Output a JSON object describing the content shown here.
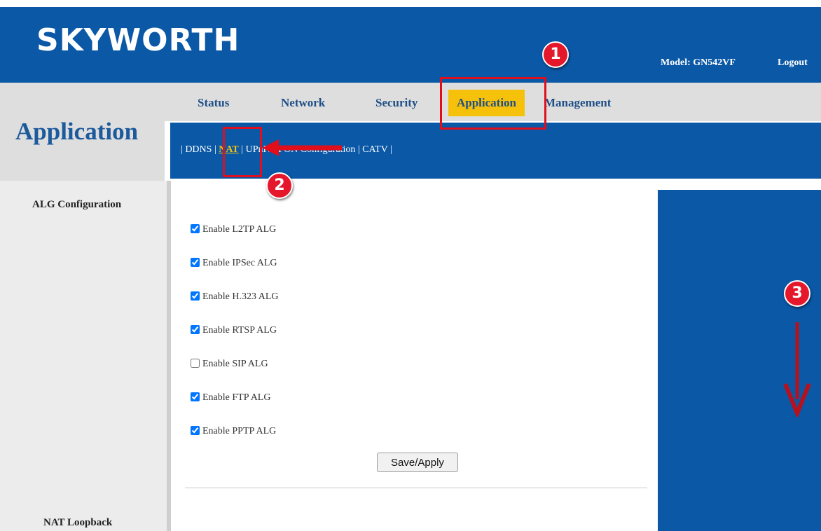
{
  "header": {
    "logo": "SKYWORTH",
    "model_label": "Model: GN542VF",
    "logout_label": "Logout"
  },
  "nav": {
    "tabs": [
      "Status",
      "Network",
      "Security",
      "Application",
      "Management"
    ],
    "active": "Application"
  },
  "page_title": "Application",
  "subnav": {
    "items": [
      "DDNS",
      "NAT",
      "UPnP/DPON Configuration",
      "CATV"
    ],
    "active": "NAT"
  },
  "sidebar": {
    "items": [
      "ALG Configuration",
      "NAT Loopback"
    ]
  },
  "alg_options": [
    {
      "label": "Enable L2TP ALG",
      "checked": true
    },
    {
      "label": "Enable IPSec ALG",
      "checked": true
    },
    {
      "label": "Enable H.323 ALG",
      "checked": true
    },
    {
      "label": "Enable RTSP ALG",
      "checked": true
    },
    {
      "label": "Enable SIP ALG",
      "checked": false
    },
    {
      "label": "Enable FTP ALG",
      "checked": true
    },
    {
      "label": "Enable PPTP ALG",
      "checked": true
    }
  ],
  "save_label": "Save/Apply",
  "annotations": [
    "1",
    "2",
    "3"
  ],
  "colors": {
    "brand_blue": "#0a58a6",
    "active_tab": "#f6c10b",
    "annotation_red": "#e10e1c"
  }
}
